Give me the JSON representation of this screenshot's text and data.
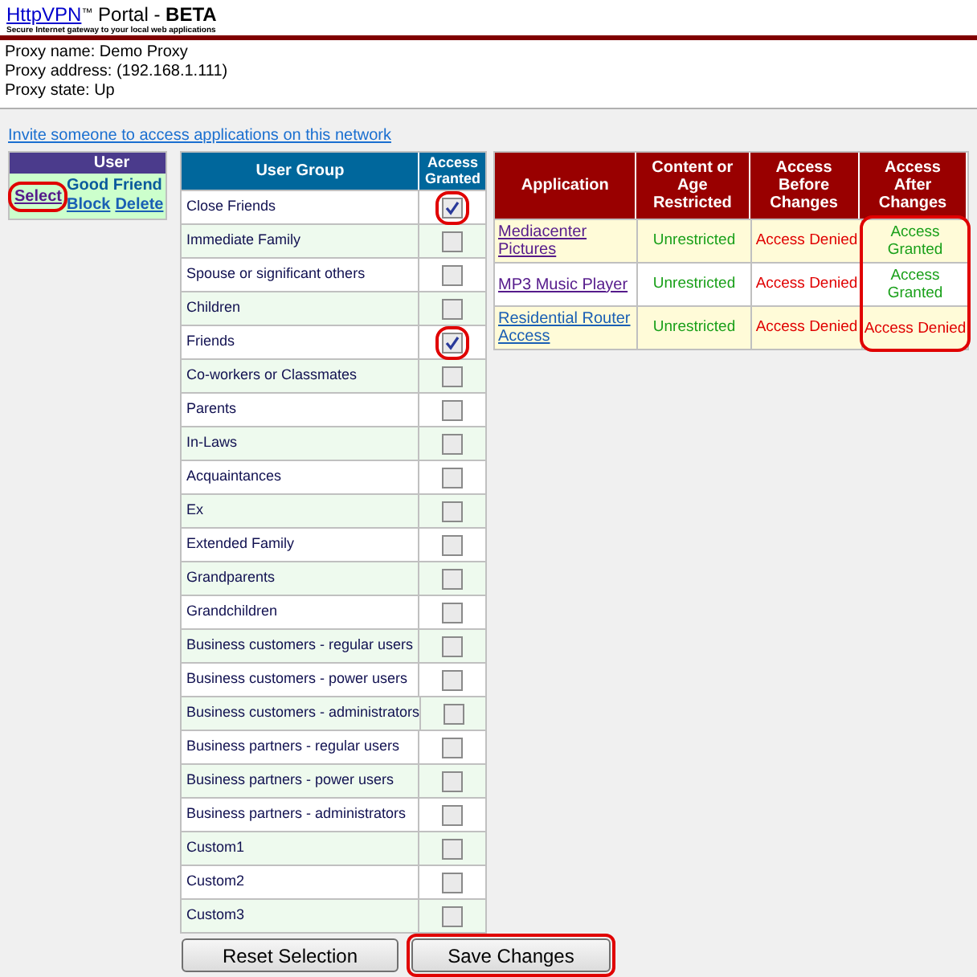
{
  "header": {
    "brand": "HttpVPN",
    "tm": "™",
    "title": " Portal - ",
    "beta": "BETA",
    "tagline": "Secure Internet gateway to your local web applications"
  },
  "proxy_info": [
    "Proxy name: Demo Proxy",
    "Proxy address: (192.168.1.111)",
    "Proxy state: Up"
  ],
  "invite_link": "Invite someone to access applications on this network",
  "user_table": {
    "heading": "User",
    "select": {
      "label": "Select",
      "highlighted": true
    },
    "name": "Good Friend",
    "actions": [
      "Block",
      "Delete"
    ]
  },
  "group_table": {
    "columns": [
      "User Group",
      "Access Granted"
    ],
    "rows": [
      {
        "name": "Close Friends",
        "checked": true,
        "highlighted": true
      },
      {
        "name": "Immediate Family",
        "checked": false,
        "highlighted": false
      },
      {
        "name": "Spouse or significant others",
        "checked": false,
        "highlighted": false
      },
      {
        "name": "Children",
        "checked": false,
        "highlighted": false
      },
      {
        "name": "Friends",
        "checked": true,
        "highlighted": true
      },
      {
        "name": "Co-workers or Classmates",
        "checked": false,
        "highlighted": false
      },
      {
        "name": "Parents",
        "checked": false,
        "highlighted": false
      },
      {
        "name": "In-Laws",
        "checked": false,
        "highlighted": false
      },
      {
        "name": "Acquaintances",
        "checked": false,
        "highlighted": false
      },
      {
        "name": "Ex",
        "checked": false,
        "highlighted": false
      },
      {
        "name": "Extended Family",
        "checked": false,
        "highlighted": false
      },
      {
        "name": "Grandparents",
        "checked": false,
        "highlighted": false
      },
      {
        "name": "Grandchildren",
        "checked": false,
        "highlighted": false
      },
      {
        "name": "Business customers - regular users",
        "checked": false,
        "highlighted": false
      },
      {
        "name": "Business customers - power users",
        "checked": false,
        "highlighted": false
      },
      {
        "name": "Business customers - administrators",
        "checked": false,
        "highlighted": false
      },
      {
        "name": "Business partners - regular users",
        "checked": false,
        "highlighted": false
      },
      {
        "name": "Business partners - power users",
        "checked": false,
        "highlighted": false
      },
      {
        "name": "Business partners - administrators",
        "checked": false,
        "highlighted": false
      },
      {
        "name": "Custom1",
        "checked": false,
        "highlighted": false
      },
      {
        "name": "Custom2",
        "checked": false,
        "highlighted": false
      },
      {
        "name": "Custom3",
        "checked": false,
        "highlighted": false
      }
    ]
  },
  "app_table": {
    "columns": [
      "Application",
      "Content or Age Restricted",
      "Access Before Changes",
      "Access After Changes"
    ],
    "after_highlighted": true,
    "rows": [
      {
        "app": "Mediacenter Pictures",
        "visited": true,
        "restriction": "Unrestricted",
        "before": {
          "text": "Access Denied",
          "kind": "denied"
        },
        "after": {
          "text": "Access Granted",
          "kind": "granted"
        }
      },
      {
        "app": "MP3 Music Player",
        "visited": true,
        "restriction": "Unrestricted",
        "before": {
          "text": "Access Denied",
          "kind": "denied"
        },
        "after": {
          "text": "Access Granted",
          "kind": "granted"
        }
      },
      {
        "app": "Residential Router Access",
        "visited": false,
        "restriction": "Unrestricted",
        "before": {
          "text": "Access Denied",
          "kind": "denied"
        },
        "after": {
          "text": "Access Denied",
          "kind": "denied"
        }
      }
    ]
  },
  "buttons": [
    {
      "label": "Reset Selection",
      "highlighted": false
    },
    {
      "label": "Save Changes",
      "highlighted": true
    }
  ]
}
